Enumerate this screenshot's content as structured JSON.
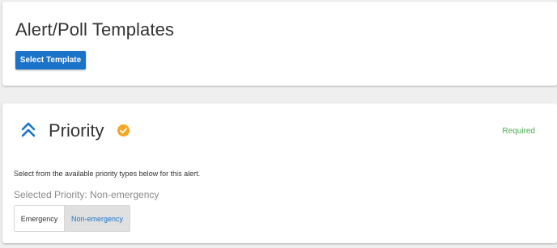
{
  "templates": {
    "title": "Alert/Poll Templates",
    "select_button_label": "Select Template"
  },
  "priority": {
    "title": "Priority",
    "required_label": "Required",
    "instructions": "Select from the available priority types below for this alert.",
    "selected_text": "Selected Priority: Non-emergency",
    "options": [
      {
        "label": "Emergency",
        "selected": false
      },
      {
        "label": "Non-emergency",
        "selected": true
      }
    ],
    "icons": {
      "collapse": "double-chevron-up-icon",
      "complete": "check-circle-icon"
    }
  },
  "colors": {
    "accent": "#1a73c8",
    "required": "#4caf50",
    "check_badge": "#f5a623"
  }
}
